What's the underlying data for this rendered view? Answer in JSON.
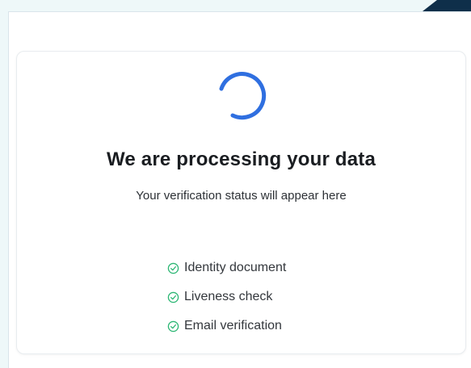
{
  "theme": {
    "accent": "#2f6fe0",
    "success": "#2bb673",
    "header_accent": "#0f2f4a"
  },
  "status": {
    "loading_icon": "spinner-icon",
    "heading": "We are processing your data",
    "subtitle": "Your verification status will appear here"
  },
  "checklist": [
    {
      "icon": "check-circle-icon",
      "label": "Identity document"
    },
    {
      "icon": "check-circle-icon",
      "label": "Liveness check"
    },
    {
      "icon": "check-circle-icon",
      "label": "Email verification"
    }
  ]
}
